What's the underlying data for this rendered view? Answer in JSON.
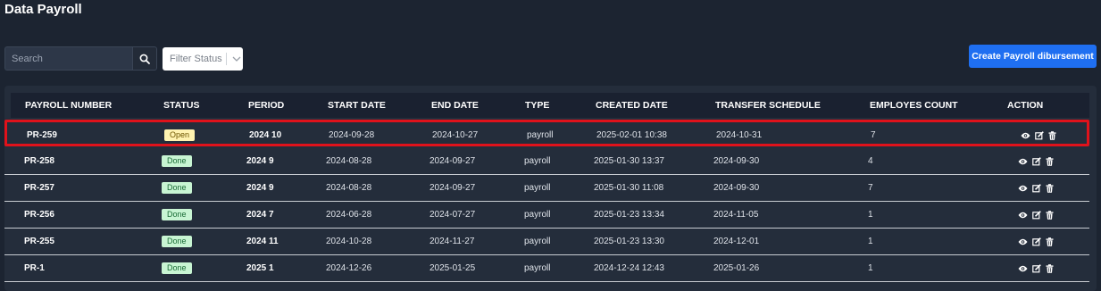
{
  "page": {
    "title": "Data Payroll"
  },
  "search": {
    "placeholder": "Search"
  },
  "filter": {
    "placeholder": "Filter Status"
  },
  "create_button": {
    "label": "Create Payroll dibursement"
  },
  "colors": {
    "accent": "#1f6ff1",
    "highlight": "#e0121b",
    "open_badge": "#fff3b0",
    "done_badge": "#c8f5d3"
  },
  "icons": {
    "search": "search-icon",
    "view": "eye-icon",
    "edit": "edit-icon",
    "delete": "trash-icon",
    "dropdown": "chevron-down-icon"
  },
  "table": {
    "headers": [
      "PAYROLL NUMBER",
      "STATUS",
      "PERIOD",
      "START DATE",
      "END DATE",
      "TYPE",
      "CREATED DATE",
      "TRANSFER SCHEDULE",
      "EMPLOYES COUNT",
      "ACTION"
    ],
    "rows": [
      {
        "number": "PR-259",
        "status": "Open",
        "period": "2024 10",
        "start": "2024-09-28",
        "end": "2024-10-27",
        "type": "payroll",
        "created": "2025-02-01 10:38",
        "transfer": "2024-10-31",
        "count": "7"
      },
      {
        "number": "PR-258",
        "status": "Done",
        "period": "2024 9",
        "start": "2024-08-28",
        "end": "2024-09-27",
        "type": "payroll",
        "created": "2025-01-30 13:37",
        "transfer": "2024-09-30",
        "count": "4"
      },
      {
        "number": "PR-257",
        "status": "Done",
        "period": "2024 9",
        "start": "2024-08-28",
        "end": "2024-09-27",
        "type": "payroll",
        "created": "2025-01-30 11:08",
        "transfer": "2024-09-30",
        "count": "7"
      },
      {
        "number": "PR-256",
        "status": "Done",
        "period": "2024 7",
        "start": "2024-06-28",
        "end": "2024-07-27",
        "type": "payroll",
        "created": "2025-01-23 13:34",
        "transfer": "2024-11-05",
        "count": "1"
      },
      {
        "number": "PR-255",
        "status": "Done",
        "period": "2024 11",
        "start": "2024-10-28",
        "end": "2024-11-27",
        "type": "payroll",
        "created": "2025-01-23 13:30",
        "transfer": "2024-12-01",
        "count": "1"
      },
      {
        "number": "PR-1",
        "status": "Done",
        "period": "2025 1",
        "start": "2024-12-26",
        "end": "2025-01-25",
        "type": "payroll",
        "created": "2024-12-24 12:43",
        "transfer": "2025-01-26",
        "count": "1"
      }
    ]
  }
}
